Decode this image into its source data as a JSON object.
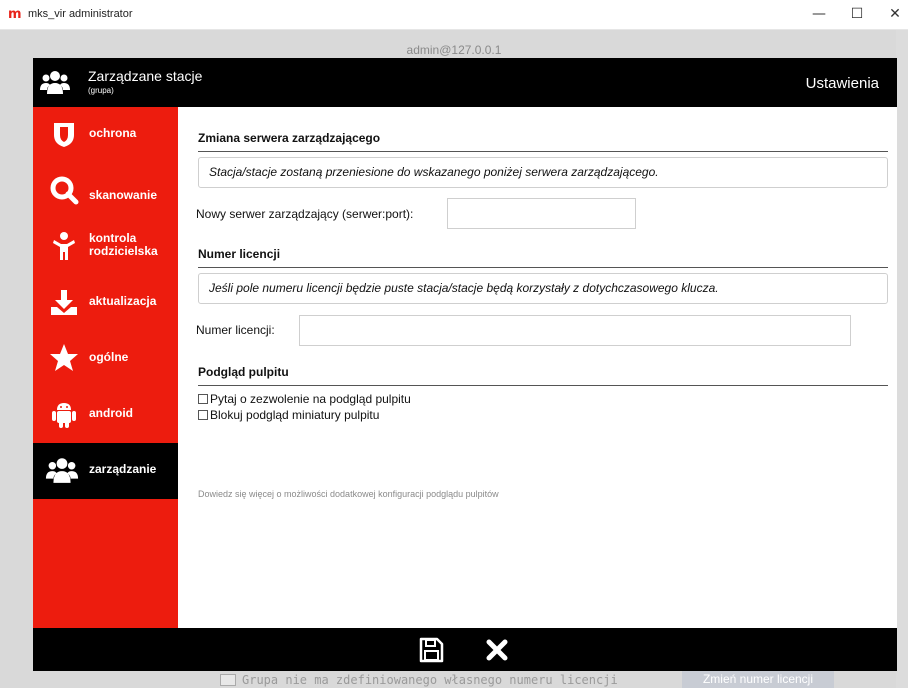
{
  "window": {
    "title": "mks_vir administrator",
    "app_logo": "m",
    "minimize_glyph": "—",
    "maximize_glyph": "☐",
    "close_glyph": "✕"
  },
  "background": {
    "host": "admin@127.0.0.1",
    "bottom_text": "Grupa nie ma zdefiniowanego własnego numeru licencji",
    "bottom_button": "Zmień numer licencji"
  },
  "dialog": {
    "header": {
      "title": "Zarządzane stacje",
      "subtitle": "(grupa)",
      "right": "Ustawienia",
      "icon": "group-icon"
    },
    "sidebar": {
      "items": [
        {
          "label": "ochrona",
          "icon": "shield-icon"
        },
        {
          "label": "skanowanie",
          "icon": "magnifier-icon"
        },
        {
          "label_line1": "kontrola",
          "label_line2": "rodzicielska",
          "icon": "child-icon"
        },
        {
          "label": "aktualizacja",
          "icon": "download-icon"
        },
        {
          "label": "ogólne",
          "icon": "star-icon"
        },
        {
          "label": "android",
          "icon": "android-icon"
        },
        {
          "label": "zarządzanie",
          "icon": "group-icon",
          "active": true
        }
      ]
    },
    "content": {
      "server_section": {
        "heading": "Zmiana serwera zarządzającego",
        "info": "Stacja/stacje zostaną przeniesione do wskazanego poniżej serwera zarządzającego.",
        "field_label": "Nowy serwer zarządzający (serwer:port):",
        "field_value": ""
      },
      "license_section": {
        "heading": "Numer licencji",
        "info": "Jeśli pole numeru licencji będzie puste stacja/stacje będą korzystały z dotychczasowego klucza.",
        "field_label": "Numer licencji:",
        "field_value": ""
      },
      "desktop_section": {
        "heading": "Podgląd pulpitu",
        "checkboxes": [
          {
            "label": "Pytaj o zezwolenie na podgląd pulpitu",
            "checked": false
          },
          {
            "label": "Blokuj podgląd miniatury pulpitu",
            "checked": false
          }
        ],
        "more_link": "Dowiedz się więcej o możliwości dodatkowej konfiguracji podglądu pulpitów"
      }
    },
    "footer": {
      "save_icon": "save-icon",
      "close_icon": "close-icon"
    }
  }
}
